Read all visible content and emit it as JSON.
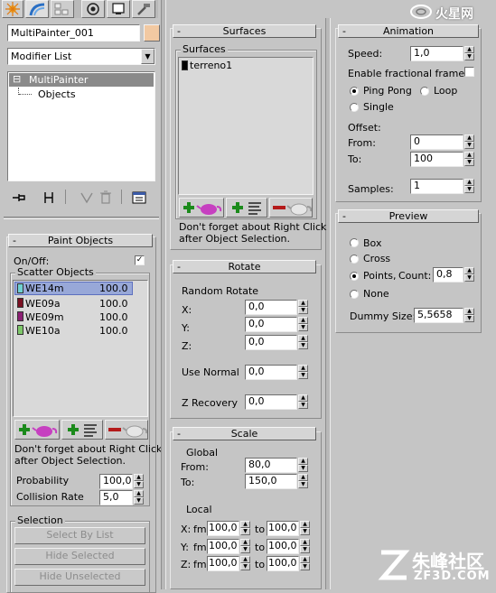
{
  "toolbar": {
    "tabs": [
      {
        "name": "create-tab-icon"
      },
      {
        "name": "modify-tab-icon"
      },
      {
        "name": "hierarchy-tab-icon"
      },
      {
        "name": "motion-tab-icon"
      },
      {
        "name": "display-tab-icon"
      },
      {
        "name": "utilities-tab-icon"
      }
    ]
  },
  "watermark_top": "火星网",
  "watermark_bottom": {
    "cn": "朱峰社区",
    "en": "ZF3D.COM"
  },
  "modifier_panel": {
    "object_name": "MultiPainter_001",
    "object_color": "#f2c9a2",
    "modifier_list_label": "Modifier List",
    "stack": [
      {
        "label": "MultiPainter",
        "expander": "⊟"
      },
      {
        "label": "Objects"
      }
    ]
  },
  "paint_objects": {
    "title": "Paint Objects",
    "on_off_label": "On/Off:",
    "on_off_checked": "✓",
    "scatter_group": "Scatter Objects",
    "items": [
      {
        "name": "WE14m",
        "value": "100.0",
        "color": "#6fd1d1"
      },
      {
        "name": "WE09a",
        "value": "100.0",
        "color": "#7a1022"
      },
      {
        "name": "WE09m",
        "value": "100.0",
        "color": "#8c1f74"
      },
      {
        "name": "WE10a",
        "value": "100.0",
        "color": "#7ec76a"
      }
    ],
    "hint": [
      "Don't forget about Right Click",
      "after Object Selection."
    ],
    "probability_label": "Probability",
    "probability_value": "100,0",
    "collision_label": "Collision Rate",
    "collision_value": "5,0",
    "selection_group": "Selection",
    "selection_buttons": [
      "Select By List",
      "Hide Selected",
      "Hide Unselected"
    ]
  },
  "surfaces": {
    "title": "Surfaces",
    "group": "Surfaces",
    "items": [
      "terreno1"
    ],
    "hint": [
      "Don't forget about Right Click",
      "after Object Selection."
    ]
  },
  "rotate": {
    "title": "Rotate",
    "random_label": "Random Rotate",
    "x_label": "X:",
    "x_value": "0,0",
    "y_label": "Y:",
    "y_value": "0,0",
    "z_label": "Z:",
    "z_value": "0,0",
    "use_normal_label": "Use Normal",
    "use_normal_value": "0,0",
    "z_recovery_label": "Z Recovery",
    "z_recovery_value": "0,0"
  },
  "scale": {
    "title": "Scale",
    "global_label": "Global",
    "from_label": "From:",
    "from_value": "80,0",
    "to_label": "To:",
    "to_value": "150,0",
    "local_label": "Local",
    "fm_label": "fm",
    "to_short": "to",
    "rows": [
      {
        "axis": "X:",
        "fm": "100,0",
        "to": "100,0"
      },
      {
        "axis": "Y:",
        "fm": "100,0",
        "to": "100,0"
      },
      {
        "axis": "Z:",
        "fm": "100,0",
        "to": "100,0"
      }
    ]
  },
  "animation": {
    "title": "Animation",
    "speed_label": "Speed:",
    "speed_value": "1,0",
    "fractional_label": "Enable fractional frames",
    "ping_pong_label": "Ping Pong",
    "loop_label": "Loop",
    "single_label": "Single",
    "offset_label": "Offset:",
    "from_label": "From:",
    "from_value": "0",
    "to_label": "To:",
    "to_value": "100",
    "samples_label": "Samples:",
    "samples_value": "1"
  },
  "preview": {
    "title": "Preview",
    "box_label": "Box",
    "cross_label": "Cross",
    "points_label": "Points,",
    "count_label": "Count:",
    "count_value": "0,8",
    "none_label": "None",
    "dummy_label": "Dummy Size:",
    "dummy_value": "5,5658"
  }
}
